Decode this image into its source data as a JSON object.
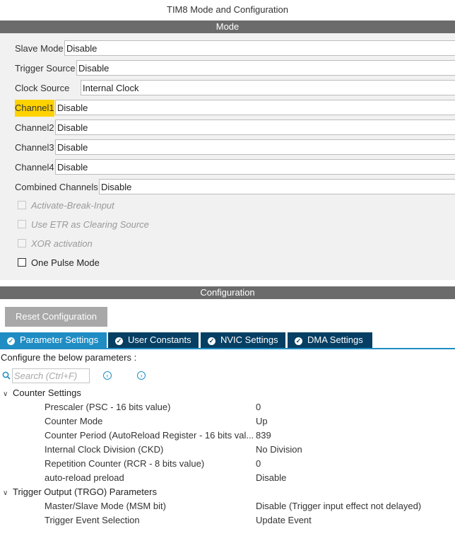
{
  "window": {
    "title": "TIM8 Mode and Configuration"
  },
  "mode": {
    "header": "Mode",
    "fields": [
      {
        "label": "Slave Mode",
        "value": "Disable"
      },
      {
        "label": "Trigger Source",
        "value": "Disable"
      },
      {
        "label": "Clock Source",
        "value": "Internal Clock"
      },
      {
        "label": "Channel1",
        "value": "Disable"
      },
      {
        "label": "Channel2",
        "value": "Disable"
      },
      {
        "label": "Channel3",
        "value": "Disable"
      },
      {
        "label": "Channel4",
        "value": "Disable"
      },
      {
        "label": "Combined Channels",
        "value": "Disable"
      }
    ],
    "checkboxes": [
      {
        "label": "Activate-Break-Input",
        "enabled": false,
        "checked": false
      },
      {
        "label": "Use ETR as Clearing Source",
        "enabled": false,
        "checked": false
      },
      {
        "label": "XOR activation",
        "enabled": false,
        "checked": false
      },
      {
        "label": "One Pulse Mode",
        "enabled": true,
        "checked": false
      }
    ]
  },
  "configuration": {
    "header": "Configuration",
    "reset_label": "Reset Configuration",
    "tabs": [
      {
        "label": "Parameter Settings",
        "icon": "check-circle-icon",
        "active": true
      },
      {
        "label": "User Constants",
        "icon": "check-circle-icon",
        "active": false
      },
      {
        "label": "NVIC Settings",
        "icon": "check-circle-icon",
        "active": false
      },
      {
        "label": "DMA Settings",
        "icon": "check-circle-icon",
        "active": false
      }
    ],
    "configure_label": "Configure the below parameters :",
    "search": {
      "placeholder": "Search (Ctrl+F)",
      "value": ""
    },
    "groups": [
      {
        "label": "Counter Settings",
        "params": [
          {
            "name": "Prescaler (PSC - 16 bits value)",
            "value": "0"
          },
          {
            "name": "Counter Mode",
            "value": "Up"
          },
          {
            "name": "Counter Period (AutoReload Register - 16 bits val...",
            "value": "839"
          },
          {
            "name": "Internal Clock Division (CKD)",
            "value": "No Division"
          },
          {
            "name": "Repetition Counter (RCR - 8 bits value)",
            "value": "0"
          },
          {
            "name": "auto-reload preload",
            "value": "Disable"
          }
        ]
      },
      {
        "label": "Trigger Output (TRGO) Parameters",
        "params": [
          {
            "name": "Master/Slave Mode (MSM bit)",
            "value": "Disable (Trigger input effect not delayed)"
          },
          {
            "name": "Trigger Event Selection",
            "value": "Update Event"
          }
        ]
      }
    ]
  },
  "colors": {
    "accent": "#1f8dc4",
    "tab_dark": "#063f63",
    "highlight": "#ffd200",
    "header_bar": "#6b6b6b"
  }
}
